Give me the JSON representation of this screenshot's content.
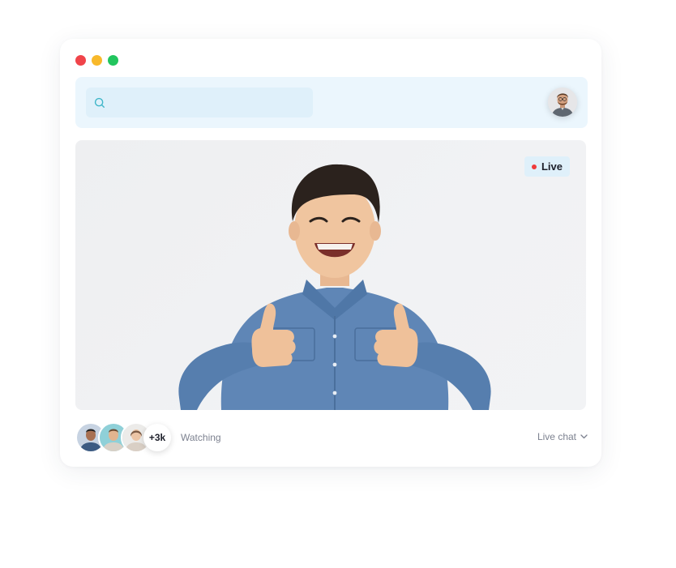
{
  "window": {
    "traffic_colors": [
      "#f0444a",
      "#f8b92b",
      "#22c55e"
    ]
  },
  "topbar": {
    "search_placeholder": "",
    "search_icon": "search-icon",
    "avatar_icon": "user-avatar"
  },
  "video": {
    "live_label": "Live",
    "live_color": "#ef3b3b"
  },
  "footer": {
    "viewer_count": "+3k",
    "watching_label": "Watching",
    "live_chat_label": "Live chat",
    "chevron_icon": "chevron-down-icon"
  }
}
